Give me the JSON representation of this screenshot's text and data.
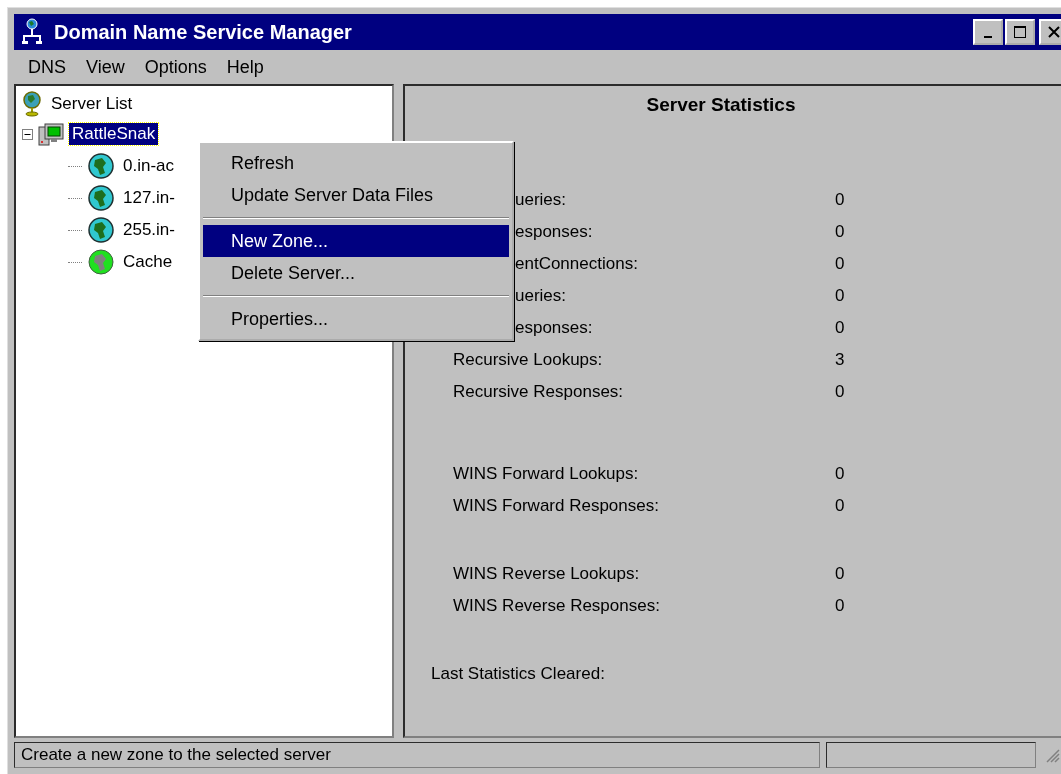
{
  "window": {
    "title": "Domain Name Service Manager"
  },
  "menu_bar": [
    {
      "label": "DNS"
    },
    {
      "label": "View"
    },
    {
      "label": "Options"
    },
    {
      "label": "Help"
    }
  ],
  "tree": {
    "label": "Server List",
    "children": [
      {
        "label": "RattleSnak",
        "kind": "server",
        "selected": true,
        "expanded": true,
        "children": [
          {
            "label": "0.in-ac",
            "kind": "zone",
            "selected": false
          },
          {
            "label": "127.in-",
            "kind": "zone",
            "selected": false
          },
          {
            "label": "255.in-",
            "kind": "zone",
            "selected": false
          },
          {
            "label": "Cache",
            "kind": "cache",
            "selected": false
          }
        ]
      }
    ]
  },
  "context_menu": [
    {
      "kind": "item",
      "label": "Refresh",
      "selected": false
    },
    {
      "kind": "item",
      "label": "Update Server Data Files",
      "selected": false
    },
    {
      "kind": "separator"
    },
    {
      "kind": "item",
      "label": "New Zone...",
      "selected": true
    },
    {
      "kind": "item",
      "label": "Delete Server...",
      "selected": false
    },
    {
      "kind": "separator"
    },
    {
      "kind": "item",
      "label": "Properties...",
      "selected": false
    }
  ],
  "statistics": {
    "title": "Server Statistics",
    "groups": [
      {
        "rows": [
          {
            "label": "ueries:",
            "kind": "covered",
            "value": "0"
          },
          {
            "label": "esponses:",
            "kind": "covered",
            "value": "0"
          },
          {
            "label": "entConnections:",
            "kind": "covered",
            "value": "0"
          },
          {
            "label": "ueries:",
            "kind": "covered",
            "value": "0"
          },
          {
            "label": "esponses:",
            "kind": "covered",
            "value": "0"
          },
          {
            "label": "Recursive Lookups:",
            "kind": "full",
            "value": "3"
          },
          {
            "label": "Recursive Responses:",
            "kind": "full",
            "value": "0"
          }
        ]
      },
      {
        "rows": [
          {
            "label": "WINS Forward Lookups:",
            "kind": "full",
            "value": "0"
          },
          {
            "label": "WINS Forward Responses:",
            "kind": "full",
            "value": "0"
          }
        ]
      },
      {
        "rows": [
          {
            "label": "WINS Reverse Lookups:",
            "kind": "full",
            "value": "0"
          },
          {
            "label": "WINS Reverse Responses:",
            "kind": "full",
            "value": "0"
          }
        ]
      }
    ],
    "footer": "Last Statistics Cleared:"
  },
  "status_bar": {
    "text": "Create a new zone to the selected server"
  }
}
